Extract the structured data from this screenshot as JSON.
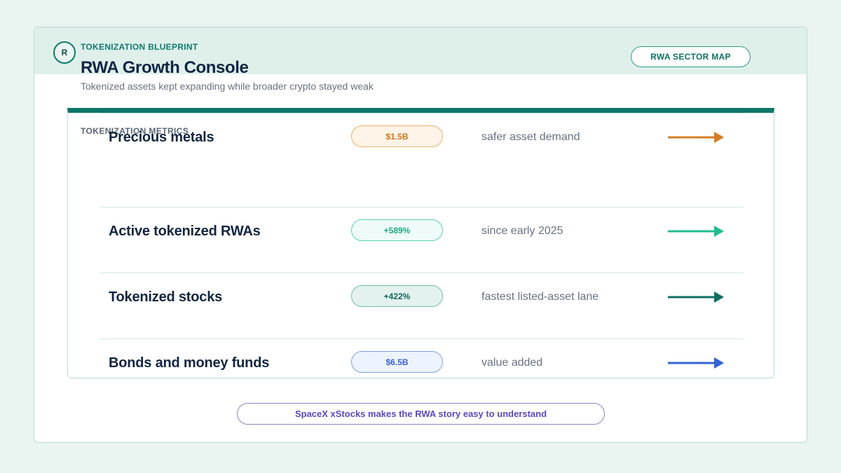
{
  "brand": {
    "logo_letter": "R",
    "kicker": "TOKENIZATION BLUEPRINT",
    "title": "RWA Growth Console",
    "subtitle": "Tokenized assets kept expanding while broader crypto stayed weak"
  },
  "actions": {
    "sector_map": "RWA SECTOR MAP",
    "footer_cta": "SpaceX xStocks makes the RWA story easy to understand"
  },
  "metrics": {
    "heading": "TOKENIZATION METRICS",
    "rows": [
      {
        "label": "Active tokenized RWAs",
        "badge": "+589%",
        "note": "since early 2025",
        "arrow_icon": "arrow-right-icon",
        "color": "#20bd8f"
      },
      {
        "label": "Tokenized stocks",
        "badge": "+422%",
        "note": "fastest listed-asset lane",
        "arrow_icon": "arrow-right-icon",
        "color": "#0f6f62"
      },
      {
        "label": "Bonds and money funds",
        "badge": "$6.5B",
        "note": "value added",
        "arrow_icon": "arrow-right-icon",
        "color": "#3562d4"
      },
      {
        "label": "Precious metals",
        "badge": "$1.5B",
        "note": "safer asset demand",
        "arrow_icon": "arrow-right-icon",
        "color": "#d57d25"
      }
    ]
  },
  "colors": {
    "brand_teal": "#0d7669",
    "background": "#eaf4f1",
    "footer_purple": "#5a48be"
  }
}
